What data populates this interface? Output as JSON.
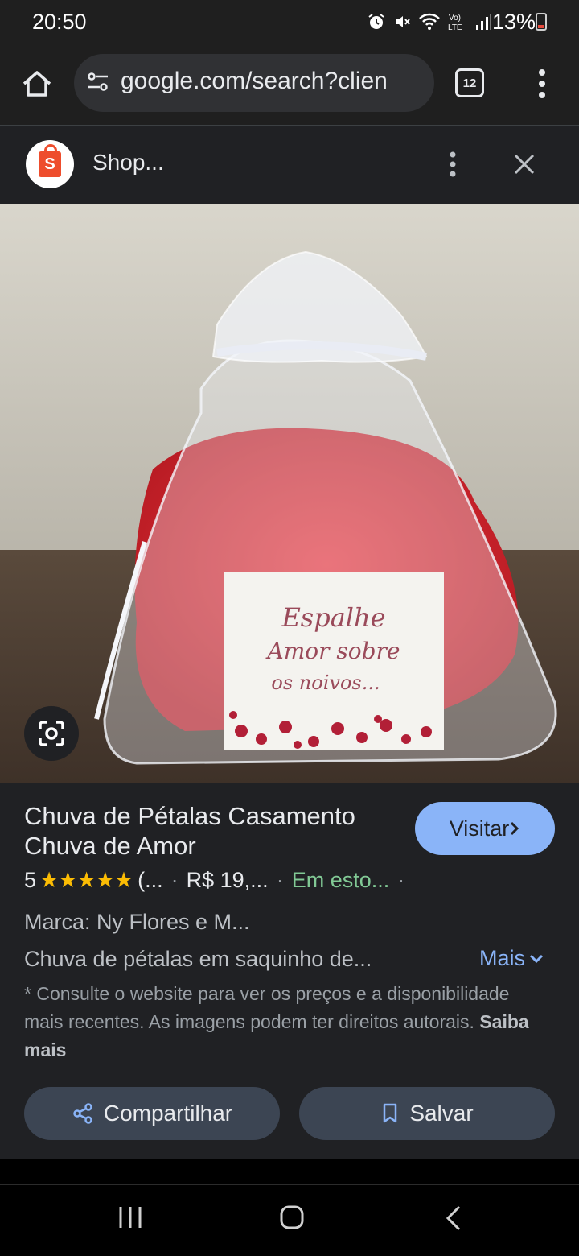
{
  "status_bar": {
    "time": "20:50",
    "battery_percent": "13%",
    "icons": [
      "alarm-icon",
      "mute-icon",
      "wifi-icon",
      "volte-icon",
      "signal-icon",
      "battery-icon"
    ]
  },
  "browser": {
    "url": "google.com/search?clien",
    "tab_count": "12"
  },
  "shop_header": {
    "name": "Shop..."
  },
  "product_image": {
    "card_line1": "Espalhe",
    "card_line2": "Amor sobre",
    "card_line3": "os noivos..."
  },
  "product": {
    "title": "Chuva de Pétalas Casamento Chuva de Amor",
    "visit_label": "Visitar",
    "rating_value": "5",
    "rating_stars": 5,
    "reviews": "(...",
    "price": "R$ 19,...",
    "availability": "Em esto...",
    "brand": "Marca: Ny Flores e M...",
    "description": "Chuva de pétalas em saquinho de...",
    "more_label": "Mais",
    "disclaimer": "* Consulte o website para ver os preços e a disponibilidade mais recentes. As imagens podem ter direitos autorais.",
    "learn_more": "Saiba mais"
  },
  "actions": {
    "share_label": "Compartilhar",
    "save_label": "Salvar"
  },
  "colors": {
    "background": "#202124",
    "accent": "#8ab4f8",
    "stars": "#fbbc04",
    "in_stock": "#81c995",
    "shop_brand": "#ee4d2d"
  }
}
